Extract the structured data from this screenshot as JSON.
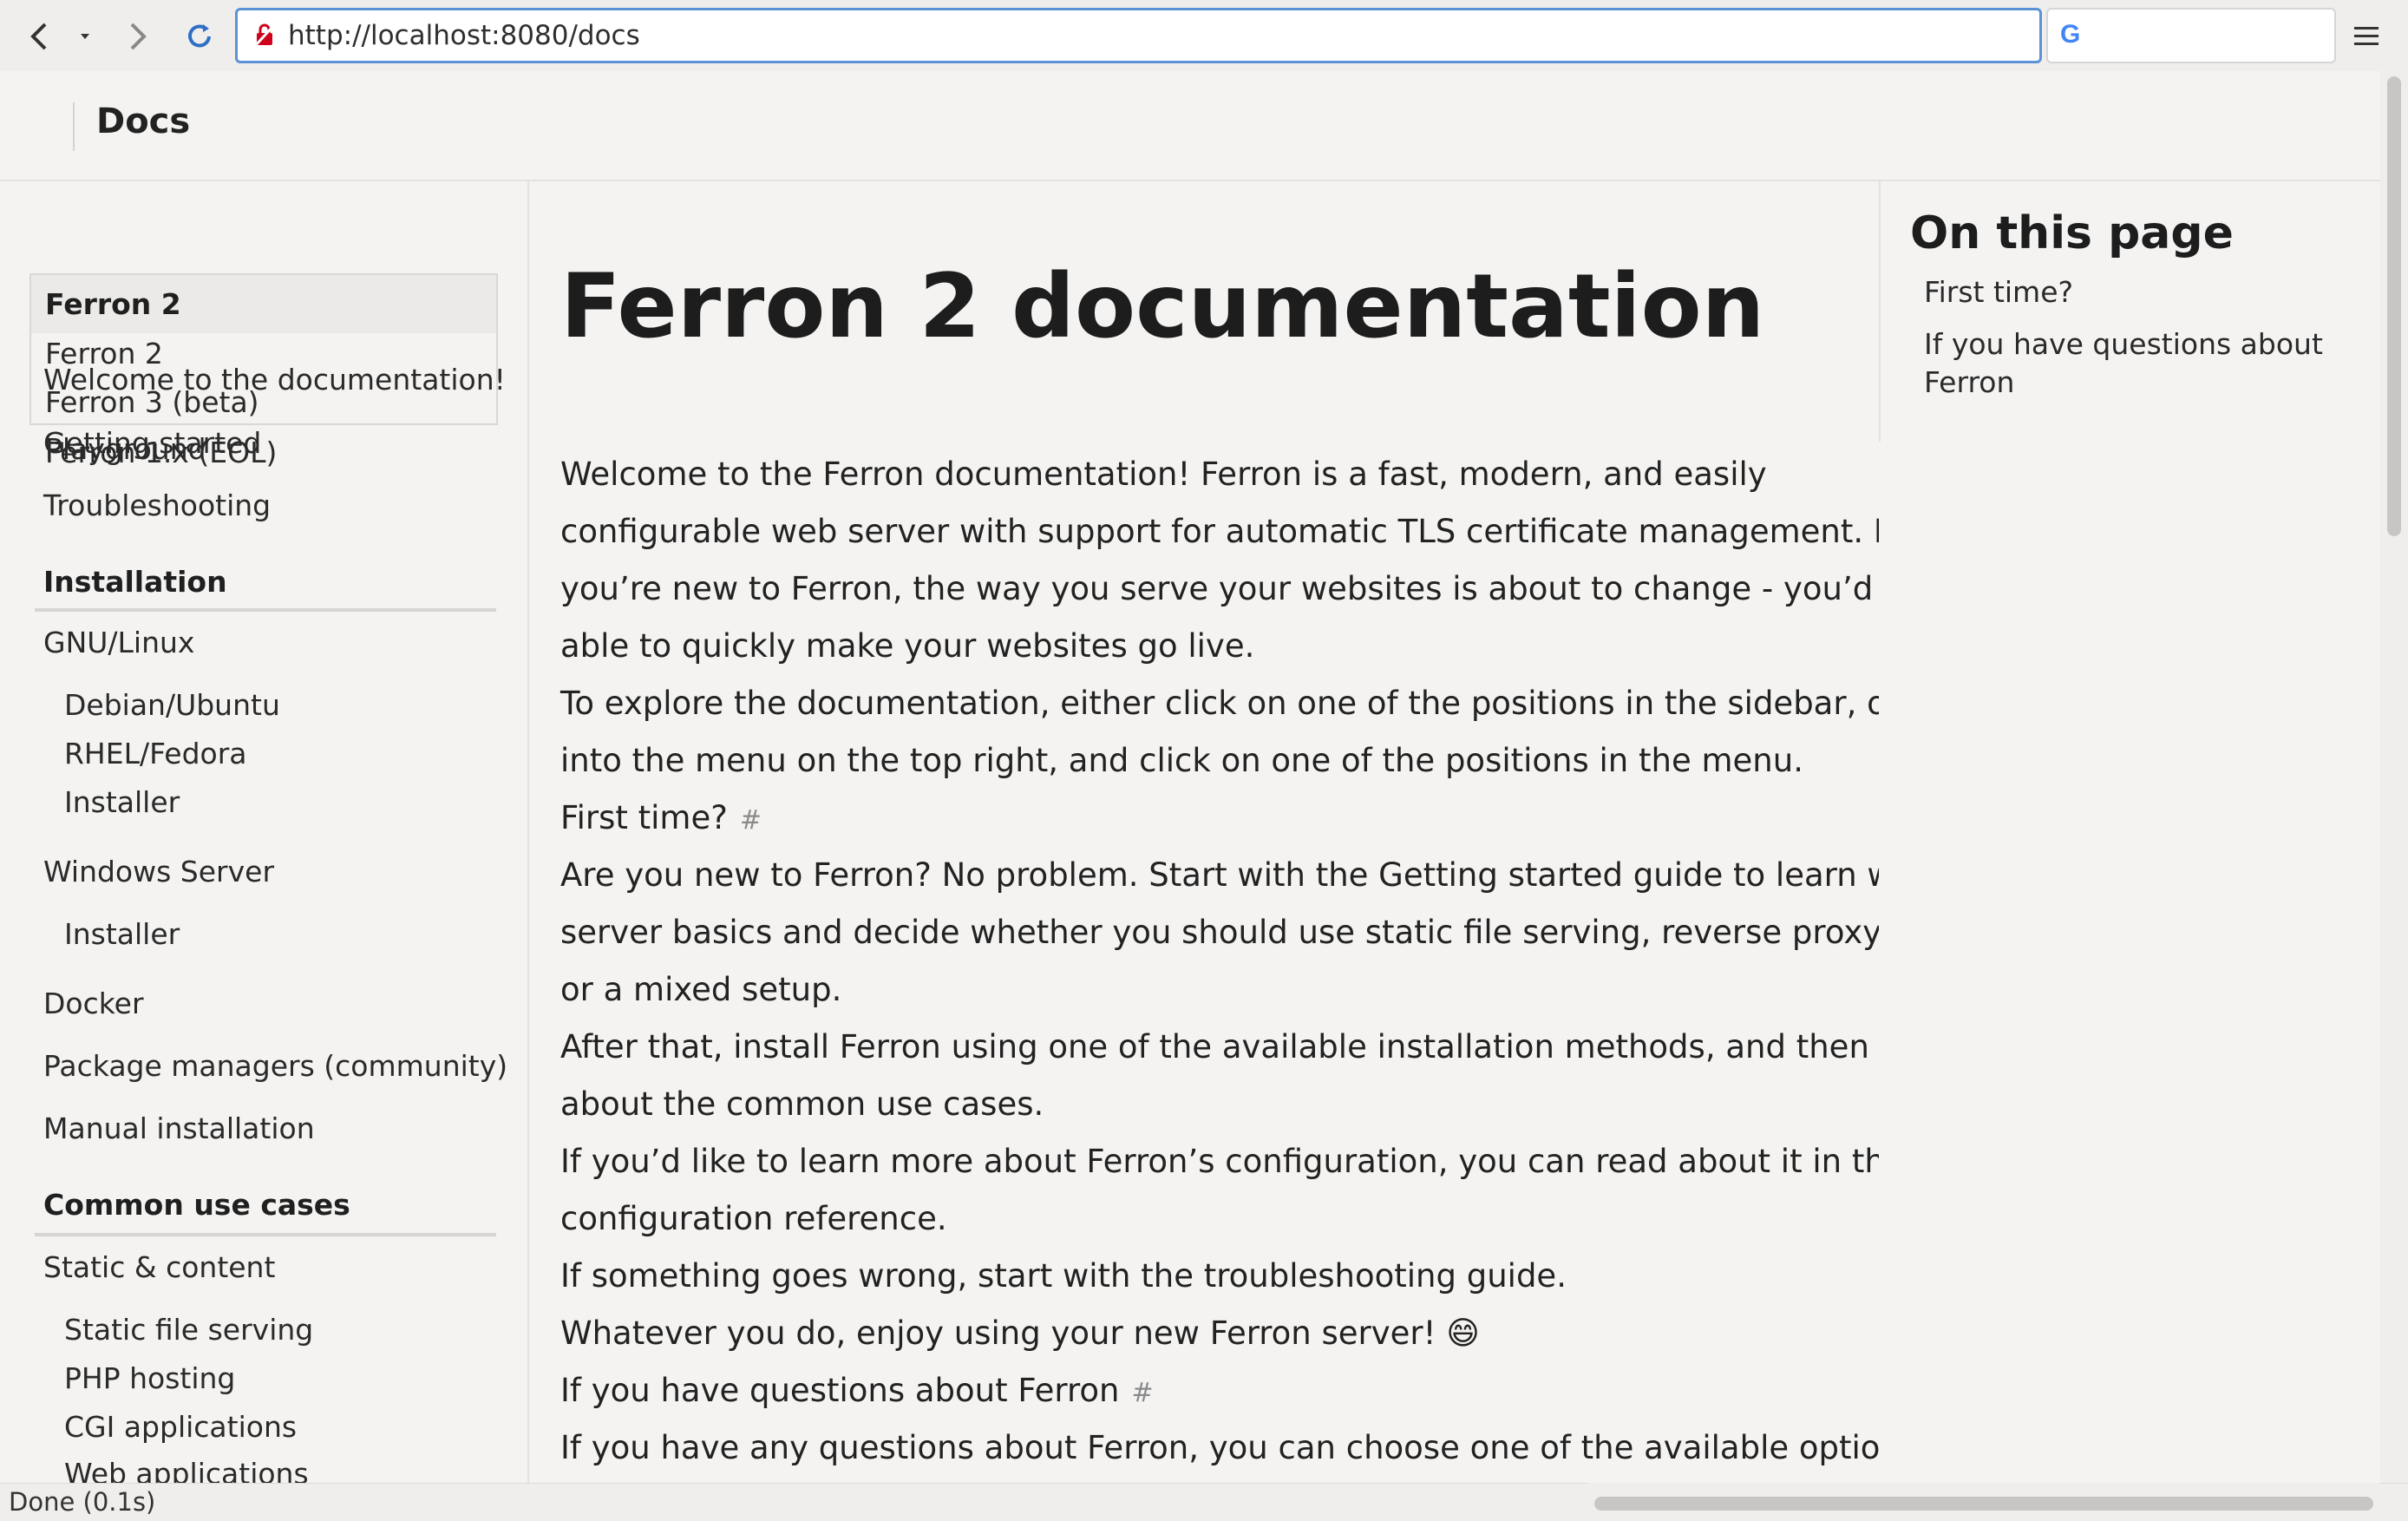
{
  "browser": {
    "url": "http://localhost:8080/docs",
    "status": "Done (0.1s)"
  },
  "header": {
    "title": "Docs"
  },
  "sidebar": {
    "version_dropdown": {
      "selected": "Ferron 2",
      "options": [
        "Ferron 2",
        "Ferron 3 (beta)",
        "Ferron 1.x (EOL)"
      ],
      "overlapping_text": [
        "Welcome to the documentation!",
        "Playground"
      ]
    },
    "top_links": [
      "Getting started",
      "Troubleshooting"
    ],
    "installation": {
      "heading": "Installation",
      "gnu_linux": "GNU/Linux",
      "gnu_linux_items": [
        "Debian/Ubuntu",
        "RHEL/Fedora",
        "Installer"
      ],
      "windows": "Windows Server",
      "windows_items": [
        "Installer"
      ],
      "docker": "Docker",
      "package_managers": "Package managers (community)",
      "manual": "Manual installation"
    },
    "use_cases": {
      "heading": "Common use cases",
      "static": "Static & content",
      "static_items": [
        "Static file serving",
        "PHP hosting",
        "CGI applications",
        "Web applications"
      ]
    }
  },
  "main": {
    "title": "Ferron 2 documentation",
    "lines": [
      "Welcome to the Ferron documentation! Ferron is a fast, modern, and easily",
      "configurable web server with support for automatic TLS certificate management. If",
      "you’re new to Ferron, the way you serve your websites is about to change - you’d be",
      "able to quickly make your websites go live.",
      "To explore the documentation, either click on one of the positions in the sidebar, or go",
      "into the menu on the top right, and click on one of the positions in the menu.",
      "First time?",
      "Are you new to Ferron? No problem. Start with the Getting started guide to learn web",
      "server basics and decide whether you should use static file serving, reverse proxying,",
      "or a mixed setup.",
      "After that, install Ferron using one of the available installation methods, and then read",
      "about the common use cases.",
      "If you’d like to learn more about Ferron’s configuration, you can read about it in the",
      "configuration reference.",
      "If something goes wrong, start with the troubleshooting guide.",
      "Whatever you do, enjoy using your new Ferron server! 😄",
      "If you have questions about Ferron",
      "If you have any questions about Ferron, you can choose one of the available options"
    ],
    "anchor_symbol": "#"
  },
  "toc": {
    "title": "On this page",
    "links": [
      "First time?",
      "If you have questions about Ferron"
    ]
  },
  "colors": {
    "focus_ring": "#5b93d6",
    "lock_red": "#d0021b"
  }
}
